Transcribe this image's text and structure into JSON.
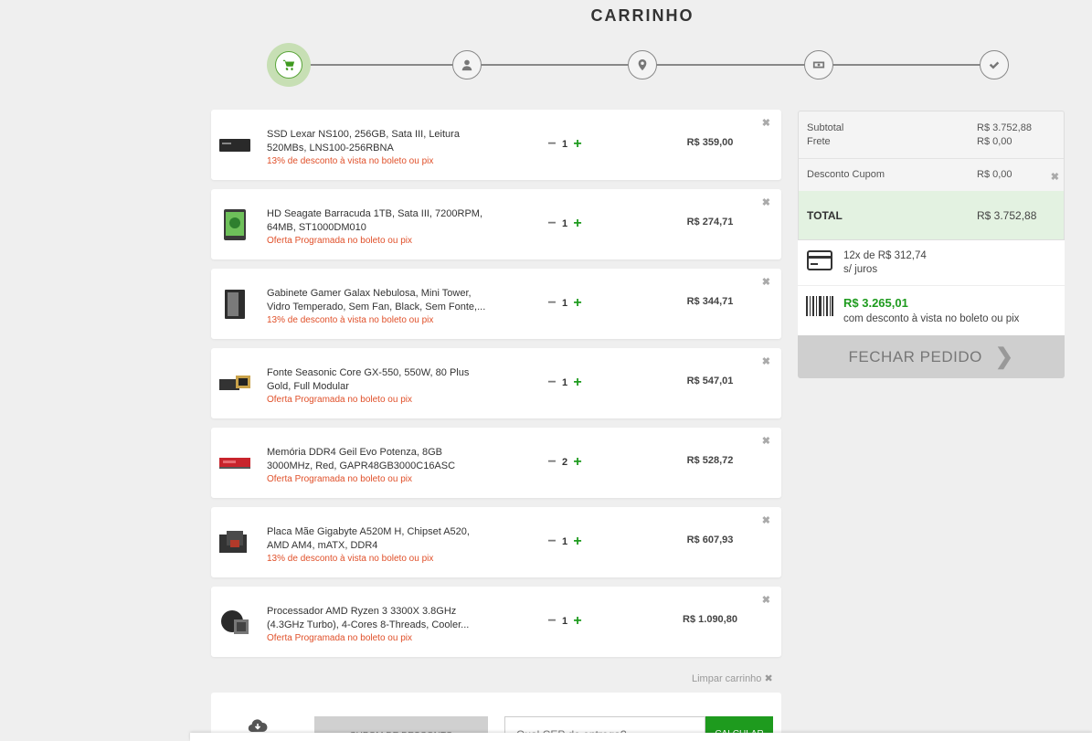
{
  "page": {
    "title": "CARRINHO"
  },
  "steps": [
    "cart",
    "user",
    "location",
    "payment",
    "confirm"
  ],
  "items": [
    {
      "name": "SSD Lexar NS100, 256GB, Sata III, Leitura 520MBs, LNS100-256RBNA",
      "note": "13% de desconto à vista no boleto ou pix",
      "qty": "1",
      "price": "R$ 359,00",
      "icon": "ssd-icon"
    },
    {
      "name": "HD Seagate Barracuda 1TB, Sata III, 7200RPM, 64MB, ST1000DM010",
      "note": "Oferta Programada no boleto ou pix",
      "qty": "1",
      "price": "R$ 274,71",
      "icon": "hdd-icon"
    },
    {
      "name": "Gabinete Gamer Galax Nebulosa, Mini Tower, Vidro Temperado, Sem Fan, Black, Sem Fonte,...",
      "note": "13% de desconto à vista no boleto ou pix",
      "qty": "1",
      "price": "R$ 344,71",
      "icon": "case-icon"
    },
    {
      "name": "Fonte Seasonic Core GX-550, 550W, 80 Plus Gold, Full Modular",
      "note": "Oferta Programada no boleto ou pix",
      "qty": "1",
      "price": "R$ 547,01",
      "icon": "psu-icon"
    },
    {
      "name": "Memória DDR4 Geil Evo Potenza, 8GB 3000MHz, Red, GAPR48GB3000C16ASC",
      "note": "Oferta Programada no boleto ou pix",
      "qty": "2",
      "price": "R$ 528,72",
      "icon": "ram-icon"
    },
    {
      "name": "Placa Mãe Gigabyte A520M H, Chipset A520, AMD AM4, mATX, DDR4",
      "note": "13% de desconto à vista no boleto ou pix",
      "qty": "1",
      "price": "R$ 607,93",
      "icon": "motherboard-icon"
    },
    {
      "name": "Processador AMD Ryzen 3 3300X 3.8GHz (4.3GHz Turbo), 4-Cores 8-Threads, Cooler...",
      "note": "Oferta Programada no boleto ou pix",
      "qty": "1",
      "price": "R$ 1.090,80",
      "icon": "cpu-icon"
    }
  ],
  "controls": {
    "minus": "−",
    "plus": "+",
    "remove": "✖"
  },
  "clear_cart": "Limpar carrinho ✖",
  "bottom": {
    "coupon_label": "CUPOM DE DESCONTO",
    "cep_placeholder": "Qual CEP de entrega?",
    "calc_label": "CALCULAR"
  },
  "summary": {
    "subtotal_label": "Subtotal",
    "subtotal_value": "R$ 3.752,88",
    "shipping_label": "Frete",
    "shipping_value": "R$ 0,00",
    "discount_label": "Desconto Cupom",
    "discount_value": "R$ 0,00",
    "total_label": "TOTAL",
    "total_value": "R$ 3.752,88",
    "installments_line1": "12x de R$ 312,74",
    "installments_line2": "s/ juros",
    "boleto_amount": "R$ 3.265,01",
    "boleto_text": "com desconto à vista no boleto ou pix",
    "checkout_label": "FECHAR PEDIDO"
  },
  "colors": {
    "accent_green": "#1e9b1e",
    "note_orange": "#e0502a",
    "total_bg": "#e3f2e1"
  }
}
